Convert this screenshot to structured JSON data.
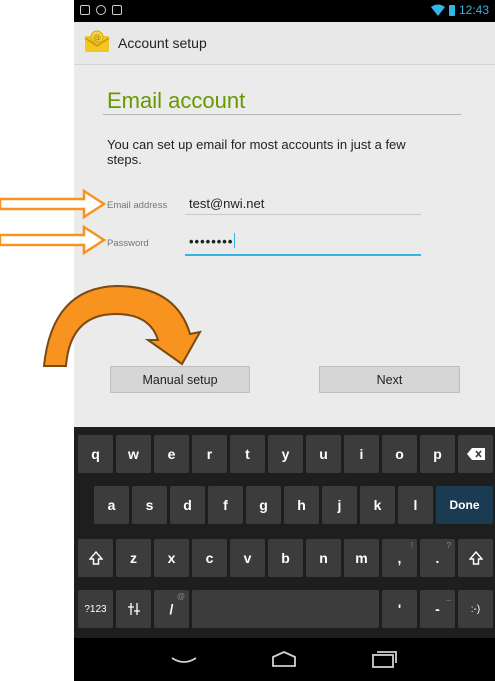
{
  "status_bar": {
    "time": "12:43"
  },
  "action_bar": {
    "title": "Account setup"
  },
  "form": {
    "heading": "Email account",
    "description": "You can set up email for most accounts in just a few steps.",
    "email_label": "Email address",
    "email_value": "test@nwi.net",
    "password_label": "Password",
    "password_value": "••••••••"
  },
  "buttons": {
    "manual_setup": "Manual setup",
    "next": "Next"
  },
  "keyboard": {
    "row1": [
      "q",
      "w",
      "e",
      "r",
      "t",
      "y",
      "u",
      "i",
      "o",
      "p"
    ],
    "row2": [
      "a",
      "s",
      "d",
      "f",
      "g",
      "h",
      "j",
      "k",
      "l"
    ],
    "row2_action": "Done",
    "row3": [
      "z",
      "x",
      "c",
      "v",
      "b",
      "n",
      "m",
      ",",
      "."
    ],
    "row3_hints": [
      "",
      "",
      "",
      "",
      "",
      "",
      "",
      "!",
      "?"
    ],
    "row4_symbols": "?123",
    "row4_slash": "/",
    "row4_slash_hint": "@",
    "row4_apostrophe": "'",
    "row4_dash": "-",
    "row4_dash_hint": "_",
    "row4_emoticon": ":-)"
  },
  "accent_colors": {
    "heading": "#669900",
    "focus": "#33b5e5",
    "annotation_arrow": "#f7931e"
  }
}
